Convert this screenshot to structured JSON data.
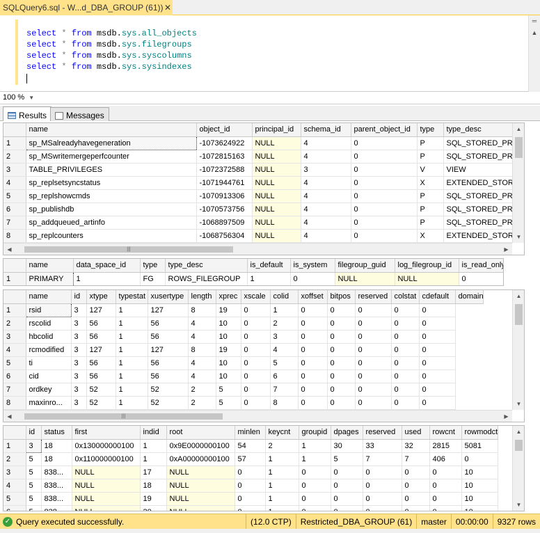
{
  "document_tab": {
    "title": "SQLQuery6.sql - W...d_DBA_GROUP (61))*",
    "close": "✕"
  },
  "editor": {
    "lines": [
      {
        "kw1": "select",
        "star": "*",
        "kw2": "from",
        "db": "msdb.",
        "obj": "sys.all_objects"
      },
      {
        "kw1": "select",
        "star": "*",
        "kw2": "from",
        "db": "msdb.",
        "obj": "sys.filegroups"
      },
      {
        "kw1": "select",
        "star": "*",
        "kw2": "from",
        "db": "msdb.",
        "obj": "sys.syscolumns"
      },
      {
        "kw1": "select",
        "star": "*",
        "kw2": "from",
        "db": "msdb.",
        "obj": "sys.sysindexes"
      }
    ]
  },
  "zoom": {
    "value": "100 %"
  },
  "result_tabs": {
    "results": "Results",
    "messages": "Messages"
  },
  "grid1": {
    "columns": [
      "name",
      "object_id",
      "principal_id",
      "schema_id",
      "parent_object_id",
      "type",
      "type_desc"
    ],
    "rows": [
      [
        "1",
        "sp_MSalreadyhavegeneration",
        "-1073624922",
        "NULL",
        "4",
        "0",
        "P",
        "SQL_STORED_PRO"
      ],
      [
        "2",
        "sp_MSwritemergeperfcounter",
        "-1072815163",
        "NULL",
        "4",
        "0",
        "P",
        "SQL_STORED_PRO"
      ],
      [
        "3",
        "TABLE_PRIVILEGES",
        "-1072372588",
        "NULL",
        "3",
        "0",
        "V",
        "VIEW"
      ],
      [
        "4",
        "sp_replsetsyncstatus",
        "-1071944761",
        "NULL",
        "4",
        "0",
        "X",
        "EXTENDED_STORE"
      ],
      [
        "5",
        "sp_replshowcmds",
        "-1070913306",
        "NULL",
        "4",
        "0",
        "P",
        "SQL_STORED_PRO"
      ],
      [
        "6",
        "sp_publishdb",
        "-1070573756",
        "NULL",
        "4",
        "0",
        "P",
        "SQL_STORED_PRO"
      ],
      [
        "7",
        "sp_addqueued_artinfo",
        "-1068897509",
        "NULL",
        "4",
        "0",
        "P",
        "SQL_STORED_PRO"
      ],
      [
        "8",
        "sp_replcounters",
        "-1068756304",
        "NULL",
        "4",
        "0",
        "X",
        "EXTENDED_STORE"
      ]
    ]
  },
  "grid2": {
    "columns": [
      "name",
      "data_space_id",
      "type",
      "type_desc",
      "is_default",
      "is_system",
      "filegroup_guid",
      "log_filegroup_id",
      "is_read_only"
    ],
    "rows": [
      [
        "1",
        "PRIMARY",
        "1",
        "FG",
        "ROWS_FILEGROUP",
        "1",
        "0",
        "NULL",
        "NULL",
        "0"
      ]
    ]
  },
  "grid3": {
    "columns": [
      "name",
      "id",
      "xtype",
      "typestat",
      "xusertype",
      "length",
      "xprec",
      "xscale",
      "colid",
      "xoffset",
      "bitpos",
      "reserved",
      "colstat",
      "cdefault",
      "domain"
    ],
    "rows": [
      [
        "1",
        "rsid",
        "3",
        "127",
        "1",
        "127",
        "8",
        "19",
        "0",
        "1",
        "0",
        "0",
        "0",
        "0",
        "0"
      ],
      [
        "2",
        "rscolid",
        "3",
        "56",
        "1",
        "56",
        "4",
        "10",
        "0",
        "2",
        "0",
        "0",
        "0",
        "0",
        "0"
      ],
      [
        "3",
        "hbcolid",
        "3",
        "56",
        "1",
        "56",
        "4",
        "10",
        "0",
        "3",
        "0",
        "0",
        "0",
        "0",
        "0"
      ],
      [
        "4",
        "rcmodified",
        "3",
        "127",
        "1",
        "127",
        "8",
        "19",
        "0",
        "4",
        "0",
        "0",
        "0",
        "0",
        "0"
      ],
      [
        "5",
        "ti",
        "3",
        "56",
        "1",
        "56",
        "4",
        "10",
        "0",
        "5",
        "0",
        "0",
        "0",
        "0",
        "0"
      ],
      [
        "6",
        "cid",
        "3",
        "56",
        "1",
        "56",
        "4",
        "10",
        "0",
        "6",
        "0",
        "0",
        "0",
        "0",
        "0"
      ],
      [
        "7",
        "ordkey",
        "3",
        "52",
        "1",
        "52",
        "2",
        "5",
        "0",
        "7",
        "0",
        "0",
        "0",
        "0",
        "0"
      ],
      [
        "8",
        "maxinro...",
        "3",
        "52",
        "1",
        "52",
        "2",
        "5",
        "0",
        "8",
        "0",
        "0",
        "0",
        "0",
        "0"
      ]
    ]
  },
  "grid4": {
    "columns": [
      "id",
      "status",
      "first",
      "indid",
      "root",
      "minlen",
      "keycnt",
      "groupid",
      "dpages",
      "reserved",
      "used",
      "rowcnt",
      "rowmodctr"
    ],
    "rows": [
      [
        "1",
        "3",
        "18",
        "0x130000000100",
        "1",
        "0x9E0000000100",
        "54",
        "2",
        "1",
        "30",
        "33",
        "32",
        "2815",
        "5081"
      ],
      [
        "2",
        "5",
        "18",
        "0x110000000100",
        "1",
        "0xA00000000100",
        "57",
        "1",
        "1",
        "5",
        "7",
        "7",
        "406",
        "0"
      ],
      [
        "3",
        "5",
        "838...",
        "NULL",
        "17",
        "NULL",
        "0",
        "1",
        "0",
        "0",
        "0",
        "0",
        "0",
        "10"
      ],
      [
        "4",
        "5",
        "838...",
        "NULL",
        "18",
        "NULL",
        "0",
        "1",
        "0",
        "0",
        "0",
        "0",
        "0",
        "10"
      ],
      [
        "5",
        "5",
        "838...",
        "NULL",
        "19",
        "NULL",
        "0",
        "1",
        "0",
        "0",
        "0",
        "0",
        "0",
        "10"
      ],
      [
        "6",
        "5",
        "838...",
        "NULL",
        "20",
        "NULL",
        "0",
        "1",
        "0",
        "0",
        "0",
        "0",
        "0",
        "10"
      ]
    ]
  },
  "status_bar": {
    "message": "Query executed successfully.",
    "version": "(12.0 CTP)",
    "login": "Restricted_DBA_GROUP (61)",
    "database": "master",
    "elapsed": "00:00:00",
    "rows": "9327 rows"
  },
  "colors": {
    "accent": "#ffe28a",
    "null_cell": "#fffde0",
    "keyword": "#0000ff",
    "object": "#008080"
  }
}
